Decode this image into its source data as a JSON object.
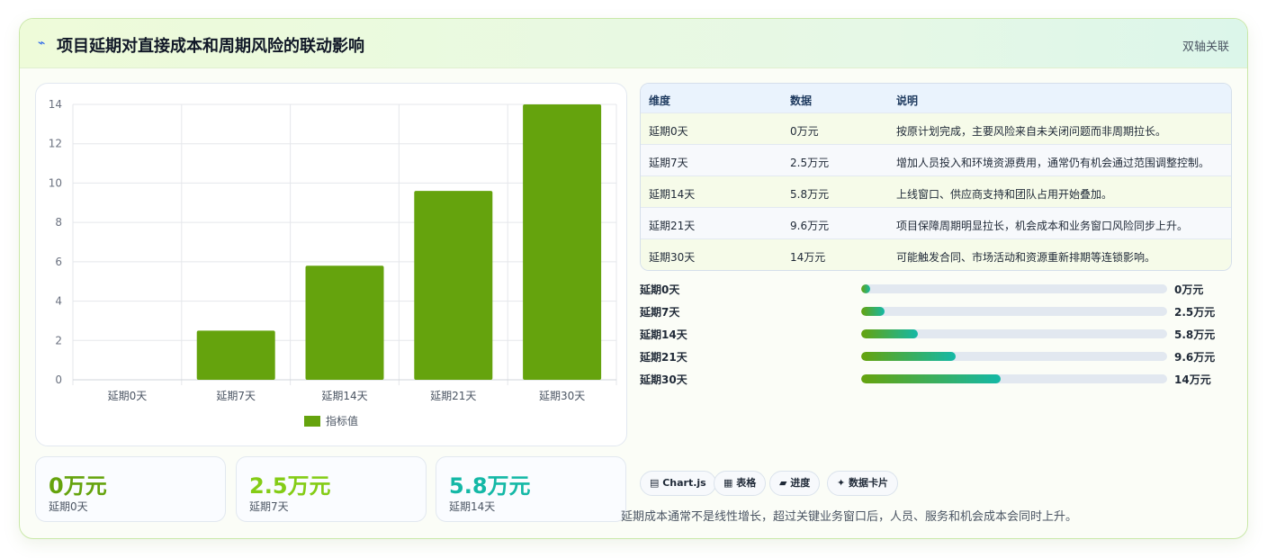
{
  "header": {
    "icon": "lightning-icon",
    "title": "项目延期对直接成本和周期风险的联动影响",
    "tag": "双轴关联"
  },
  "chart_data": {
    "type": "bar",
    "categories": [
      "延期0天",
      "延期7天",
      "延期14天",
      "延期21天",
      "延期30天"
    ],
    "series": [
      {
        "name": "指标值",
        "values": [
          0,
          2.5,
          5.8,
          9.6,
          14
        ],
        "color": "#65a30d"
      }
    ],
    "ylim": [
      0,
      14
    ],
    "yticks": [
      0,
      2,
      4,
      6,
      8,
      10,
      12,
      14
    ],
    "grid": true,
    "legend": "bottom"
  },
  "kpis": [
    {
      "value": "0万元",
      "label": "延期0天",
      "color": "#65a30d"
    },
    {
      "value": "2.5万元",
      "label": "延期7天",
      "color": "#84cc16"
    },
    {
      "value": "5.8万元",
      "label": "延期14天",
      "color": "#14b8a6"
    }
  ],
  "table": {
    "headers": [
      "维度",
      "数据",
      "说明"
    ],
    "rows": [
      [
        "延期0天",
        "0万元",
        "按原计划完成，主要风险来自未关闭问题而非周期拉长。"
      ],
      [
        "延期7天",
        "2.5万元",
        "增加人员投入和环境资源费用，通常仍有机会通过范围调整控制。"
      ],
      [
        "延期14天",
        "5.8万元",
        "上线窗口、供应商支持和团队占用开始叠加。"
      ],
      [
        "延期21天",
        "9.6万元",
        "项目保障周期明显拉长，机会成本和业务窗口风险同步上升。"
      ],
      [
        "延期30天",
        "14万元",
        "可能触发合同、市场活动和资源重新排期等连锁影响。"
      ]
    ],
    "row_colors": [
      "#f6fbe9",
      "#f7f9fc",
      "#f6fbe9",
      "#f7f9fc",
      "#f6fbe9"
    ]
  },
  "progress": [
    {
      "label": "延期0天",
      "value": "0万元",
      "fraction": 0.03
    },
    {
      "label": "延期7天",
      "value": "2.5万元",
      "fraction": 0.075
    },
    {
      "label": "延期14天",
      "value": "5.8万元",
      "fraction": 0.185
    },
    {
      "label": "延期21天",
      "value": "9.6万元",
      "fraction": 0.31
    },
    {
      "label": "延期30天",
      "value": "14万元",
      "fraction": 0.455
    }
  ],
  "tags": [
    "▤ Chart.js",
    "▦ 表格",
    "▰ 进度",
    "✦ 数据卡片"
  ],
  "note": "延期成本通常不是线性增长，超过关键业务窗口后，人员、服务和机会成本会同时上升。"
}
